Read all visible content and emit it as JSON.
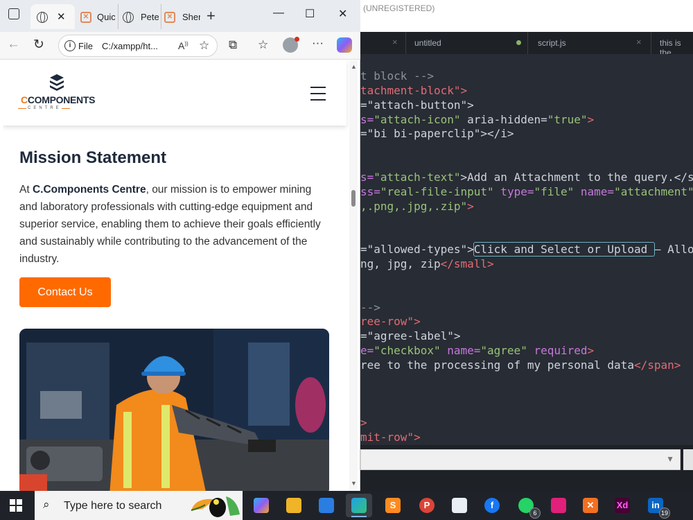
{
  "editor": {
    "title": "(UNREGISTERED)",
    "tabs": [
      {
        "label": "",
        "close": "×"
      },
      {
        "label": "untitled",
        "modified": true
      },
      {
        "label": "script.js",
        "close": "×"
      },
      {
        "label": "this is the"
      }
    ],
    "code_lines": [
      [
        [
          "cm",
          "t block -->"
        ]
      ],
      [
        [
          "tg",
          "tachment-block\">"
        ]
      ],
      [
        [
          "",
          "=\"attach-button\">"
        ]
      ],
      [
        [
          "at",
          "s="
        ],
        [
          "st",
          "\"attach-icon\""
        ],
        [
          "",
          " aria-hidden="
        ],
        [
          "st",
          "\"true\""
        ],
        [
          "tg",
          ">"
        ]
      ],
      [
        [
          "",
          "=\"bi bi-paperclip\"></i>"
        ]
      ],
      [
        [
          "",
          ""
        ]
      ],
      [
        [
          "",
          ""
        ]
      ],
      [
        [
          "at",
          "s="
        ],
        [
          "st",
          "\"attach-text\""
        ],
        [
          "",
          ">Add an Attachment to the query.</s"
        ]
      ],
      [
        [
          "at",
          "ss="
        ],
        [
          "st",
          "\"real-file-input\""
        ],
        [
          "at",
          " type="
        ],
        [
          "st",
          "\"file\""
        ],
        [
          "at",
          " name="
        ],
        [
          "st",
          "\"attachment\""
        ]
      ],
      [
        [
          "st",
          ",.png,.jpg,.zip\""
        ],
        [
          "tg",
          ">"
        ]
      ],
      [
        [
          "",
          ""
        ]
      ],
      [
        [
          "",
          ""
        ]
      ],
      [
        [
          "",
          "=\"allowed-types\">"
        ],
        [
          "hl",
          "Click and Select or Upload "
        ],
        [
          "",
          "– Allo"
        ]
      ],
      [
        [
          "",
          "ng, jpg, zip"
        ],
        [
          "tg",
          "</small>"
        ]
      ],
      [
        [
          "",
          ""
        ]
      ],
      [
        [
          "",
          ""
        ]
      ],
      [
        [
          "cm",
          "-->"
        ]
      ],
      [
        [
          "tg",
          "ree-row\">"
        ]
      ],
      [
        [
          "",
          "=\"agree-label\">"
        ]
      ],
      [
        [
          "at",
          "e="
        ],
        [
          "st",
          "\"checkbox\""
        ],
        [
          "at",
          " name="
        ],
        [
          "st",
          "\"agree\""
        ],
        [
          "at",
          " required"
        ],
        [
          "tg",
          ">"
        ]
      ],
      [
        [
          "",
          "ree to the processing of my personal data"
        ],
        [
          "tg",
          "</span>"
        ]
      ],
      [
        [
          "",
          ""
        ]
      ],
      [
        [
          "",
          ""
        ]
      ],
      [
        [
          "",
          ""
        ]
      ],
      [
        [
          "tg",
          ">"
        ]
      ],
      [
        [
          "tg",
          "mit-row\">"
        ]
      ]
    ]
  },
  "browser": {
    "tabs": [
      {
        "label": "",
        "favicon": "globe-icon",
        "active": true
      },
      {
        "label": "Quic",
        "favicon": "xampp-icon"
      },
      {
        "label": "Pete",
        "favicon": "globe-icon"
      },
      {
        "label": "Sher",
        "favicon": "xampp-icon"
      }
    ],
    "new_tab": "+",
    "address": {
      "scheme_label": "File",
      "url": "C:/xampp/ht..."
    },
    "controls": {
      "minimize": "—",
      "maximize": "☐",
      "close": "✕"
    }
  },
  "site": {
    "logo": {
      "word_c": "C",
      "word_rest": "COMPONENTS",
      "sub": "CENTRE"
    },
    "mission_title": "Mission Statement",
    "mission_lead": "At ",
    "mission_company": "C.Components Centre",
    "mission_body": ", our mission is to empower mining and laboratory professionals with cutting-edge equipment and superior service, enabling them to achieve their goals efficiently and sustainably while contributing to the advancement of the industry.",
    "contact_button": "Contact Us",
    "scroll_fraction": 0.32
  },
  "taskbar": {
    "search_placeholder": "Type here to search",
    "apps": [
      {
        "name": "copilot",
        "glyph": ""
      },
      {
        "name": "file-explorer",
        "glyph": ""
      },
      {
        "name": "store",
        "glyph": ""
      },
      {
        "name": "edge",
        "glyph": "",
        "active": true
      },
      {
        "name": "sublime-text",
        "glyph": "S"
      },
      {
        "name": "chrome",
        "glyph": "P"
      },
      {
        "name": "paint",
        "glyph": ""
      },
      {
        "name": "facebook",
        "glyph": "f"
      },
      {
        "name": "whatsapp",
        "glyph": "",
        "badge": "6"
      },
      {
        "name": "pen-tool",
        "glyph": ""
      },
      {
        "name": "xampp",
        "glyph": "✕"
      },
      {
        "name": "adobe-xd",
        "glyph": "Xd"
      },
      {
        "name": "linkedin",
        "glyph": "in",
        "badge": "19"
      }
    ]
  },
  "colors": {
    "accent": "#ff6a00",
    "brand_dark": "#1e2a3b",
    "editor_bg": "#282c34"
  }
}
